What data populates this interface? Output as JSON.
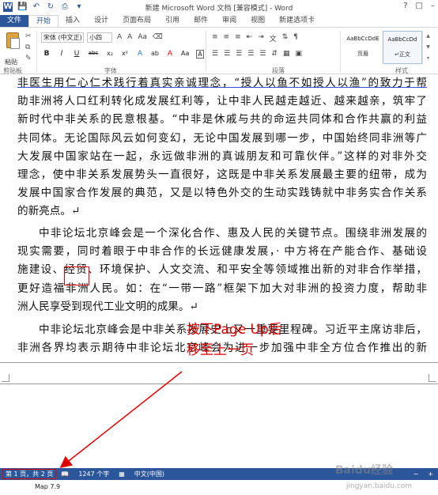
{
  "window": {
    "title": "新建 Microsoft Word 文档 [兼容模式] - Word",
    "help": "?"
  },
  "quick_access": [
    "save-icon",
    "undo-icon",
    "redo-icon",
    "print-icon",
    "customize-icon"
  ],
  "tabs": [
    "文件",
    "开始",
    "插入",
    "设计",
    "页面布局",
    "引用",
    "邮件",
    "审阅",
    "视图",
    "新建选项卡"
  ],
  "ribbon": {
    "paste": "粘贴",
    "groups": [
      "剪贴板",
      "字体",
      "段落",
      "样式"
    ],
    "font_name": "宋体 (中文正)",
    "font_size": "小四",
    "styles": [
      {
        "preview": "AaBbCcDdE",
        "name": "页眉"
      },
      {
        "preview": "AaBbCcDd",
        "name": "↵正文"
      }
    ],
    "format_buttons": [
      "B",
      "I",
      "U",
      "abc",
      "x₂",
      "x²",
      "A",
      "ab",
      "A",
      "Aa",
      "A"
    ]
  },
  "document": {
    "p1": [
      "非医生用仁心仁术践行着真实亲诚理念，“授人以鱼不如授人以渔”的致力于帮",
      "助非洲将人口红利转化成发展红利等，让中非人民越走越近、越来越亲，筑牢了",
      "新时代中非关系的民意根基。“中非是休戚与共的命运共同体和合作共赢的利益",
      "共同体。无论国际风云如何变幻，无论中国发展到哪一步，中国始终同非洲等广",
      "大发展中国家站在一起，永远做非洲的真诚朋友和可靠伙伴。”这样的对非外交",
      "理念，使中非关系发展势头一直很好，这既是中非关系发展最主要的纽带，成为",
      "发展中国家合作发展的典范，又是以特色外交的生动实践铸就中非务实合作关系",
      "的新亮点。↵"
    ],
    "p2": [
      "中非论坛北京峰会是一个深化合作、惠及人民的关键节点。围绕非洲发展的",
      "现实需要，同时着眼于中非合作的长远健康发展，· 中方将在产能合作、基础设",
      "施建设、经贸、环境保护、人文交流、和平安全等领域推出新的对非合作举措，",
      "更好造福非洲人民。如：在“一带一路”框架下加大对非洲的投资力度，帮助非",
      "洲人民享受到现代工业文明的成果。↵"
    ],
    "p3": [
      "中非论坛北京峰会是中非关系发展史上又一重要里程碑。习近平主席访非后，",
      "非洲各界均表示期待中非论坛北京峰会为进一步加强中非全方位合作推出的新"
    ]
  },
  "annotation": {
    "line1": "按下Page Up后",
    "line2": "移至上一页",
    "color": "#e00000"
  },
  "status": {
    "page": "第 1 页，共 2 页",
    "words": "1247 个字",
    "lang": "中文(中国)"
  },
  "below_status": {
    "map": "Map 7.9"
  },
  "watermark": {
    "text": "Baidu经验",
    "url": "jingyan.baidu.com"
  }
}
